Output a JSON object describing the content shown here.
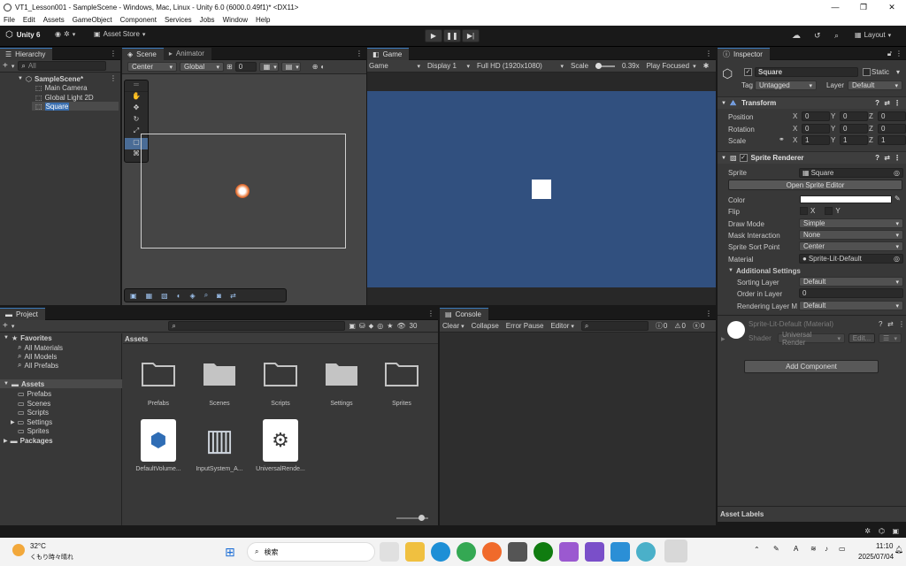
{
  "window": {
    "title": "VT1_Lesson001 - SampleScene - Windows, Mac, Linux - Unity 6.0 (6000.0.49f1)* <DX11>",
    "minimize": "—",
    "maximize": "❐",
    "close": "✕"
  },
  "menu": [
    "File",
    "Edit",
    "Assets",
    "GameObject",
    "Component",
    "Services",
    "Jobs",
    "Window",
    "Help"
  ],
  "toolbar": {
    "unity": "Unity 6",
    "asset_store": "Asset Store",
    "layout": "Layout"
  },
  "hierarchy": {
    "tab": "Hierarchy",
    "search_placeholder": "All",
    "scene": "SampleScene*",
    "items": [
      "Main Camera",
      "Global Light 2D",
      "Square"
    ]
  },
  "scene_view": {
    "tab": "Scene",
    "tab2": "Animator",
    "pivot": "Center",
    "space": "Global",
    "snap": "0"
  },
  "game_view": {
    "tab": "Game",
    "mode": "Game",
    "display": "Display 1",
    "resolution": "Full HD (1920x1080)",
    "scale_label": "Scale",
    "scale_value": "0.39x",
    "play_focused": "Play Focused",
    "bg": "#31507f"
  },
  "inspector": {
    "tab": "Inspector",
    "object_name": "Square",
    "static": "Static",
    "tag_label": "Tag",
    "tag": "Untagged",
    "layer_label": "Layer",
    "layer": "Default",
    "transform": {
      "title": "Transform",
      "rows": [
        {
          "label": "Position",
          "x": "0",
          "y": "0",
          "z": "0"
        },
        {
          "label": "Rotation",
          "x": "0",
          "y": "0",
          "z": "0"
        },
        {
          "label": "Scale",
          "x": "1",
          "y": "1",
          "z": "1"
        }
      ]
    },
    "sprite_renderer": {
      "title": "Sprite Renderer",
      "sprite_label": "Sprite",
      "sprite": "Square",
      "open_editor": "Open Sprite Editor",
      "color_label": "Color",
      "flip_label": "Flip",
      "flip_x": "X",
      "flip_y": "Y",
      "draw_mode_label": "Draw Mode",
      "draw_mode": "Simple",
      "mask_label": "Mask Interaction",
      "mask": "None",
      "sort_point_label": "Sprite Sort Point",
      "sort_point": "Center",
      "material_label": "Material",
      "material": "Sprite-Lit-Default",
      "additional": "Additional Settings",
      "sorting_layer_label": "Sorting Layer",
      "sorting_layer": "Default",
      "order_label": "Order in Layer",
      "order": "0",
      "rendering_layer_label": "Rendering Layer M",
      "rendering_layer": "Default"
    },
    "material_block": {
      "name": "Sprite-Lit-Default (Material)",
      "shader_label": "Shader",
      "shader": "Universal Render",
      "edit": "Edit..."
    },
    "add_component": "Add Component",
    "asset_labels": "Asset Labels"
  },
  "project": {
    "tab": "Project",
    "console_tab": "Console",
    "count": "30",
    "favorites": "Favorites",
    "fav_items": [
      "All Materials",
      "All Models",
      "All Prefabs"
    ],
    "assets": "Assets",
    "asset_folders": [
      "Prefabs",
      "Scenes",
      "Scripts",
      "Settings",
      "Sprites"
    ],
    "packages": "Packages",
    "breadcrumb": "Assets",
    "grid_items": [
      "Prefabs",
      "Scenes",
      "Scripts",
      "Settings",
      "Sprites"
    ],
    "grid_files": [
      "DefaultVolume...",
      "InputSystem_A...",
      "UniversalRende..."
    ]
  },
  "console": {
    "clear": "Clear",
    "collapse": "Collapse",
    "error_pause": "Error Pause",
    "editor": "Editor",
    "c1": "0",
    "c2": "0",
    "c3": "0"
  },
  "taskbar": {
    "temp": "32°C",
    "weather": "くもり時々晴れ",
    "search": "検索",
    "time": "11:10",
    "date": "2025/07/04",
    "ime": "A"
  }
}
